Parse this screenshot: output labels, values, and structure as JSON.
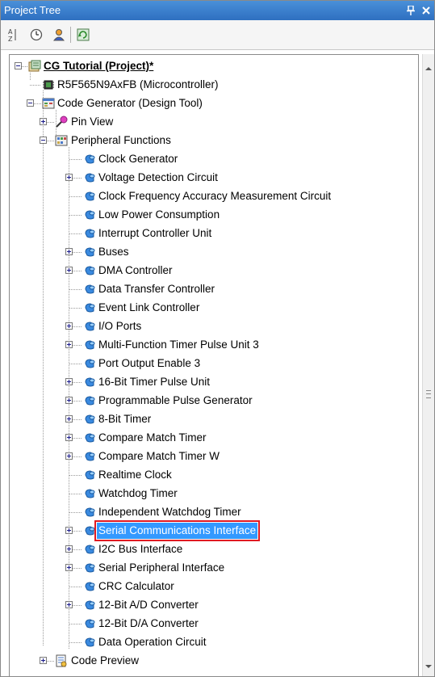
{
  "panel": {
    "title": "Project Tree",
    "pin_glyph": "4",
    "close_glyph": "X"
  },
  "toolbar": {
    "buttons": [
      {
        "icon": "sort-icon"
      },
      {
        "icon": "clock-icon"
      },
      {
        "icon": "user-icon"
      },
      {
        "icon": "refresh-icon"
      }
    ]
  },
  "tree": {
    "project": "CG Tutorial (Project)*",
    "microcontroller": "R5F565N9AxFB (Microcontroller)",
    "code_generator": "Code Generator (Design Tool)",
    "pin_view": "Pin View",
    "peripheral_functions": "Peripheral Functions",
    "peripherals": [
      {
        "label": "Clock Generator",
        "expandable": false
      },
      {
        "label": "Voltage Detection Circuit",
        "expandable": true
      },
      {
        "label": "Clock Frequency Accuracy Measurement Circuit",
        "expandable": false
      },
      {
        "label": "Low Power Consumption",
        "expandable": false
      },
      {
        "label": "Interrupt Controller Unit",
        "expandable": false
      },
      {
        "label": "Buses",
        "expandable": true
      },
      {
        "label": "DMA Controller",
        "expandable": true
      },
      {
        "label": "Data Transfer Controller",
        "expandable": false
      },
      {
        "label": "Event Link Controller",
        "expandable": false
      },
      {
        "label": "I/O Ports",
        "expandable": true
      },
      {
        "label": "Multi-Function Timer Pulse Unit 3",
        "expandable": true
      },
      {
        "label": "Port Output Enable 3",
        "expandable": false
      },
      {
        "label": "16-Bit Timer Pulse Unit",
        "expandable": true
      },
      {
        "label": "Programmable Pulse Generator",
        "expandable": true
      },
      {
        "label": "8-Bit Timer",
        "expandable": true
      },
      {
        "label": "Compare Match Timer",
        "expandable": true
      },
      {
        "label": "Compare Match Timer W",
        "expandable": true
      },
      {
        "label": "Realtime Clock",
        "expandable": false
      },
      {
        "label": "Watchdog Timer",
        "expandable": false
      },
      {
        "label": "Independent Watchdog Timer",
        "expandable": false
      },
      {
        "label": "Serial Communications Interface",
        "expandable": true,
        "selected": true
      },
      {
        "label": "I2C Bus Interface",
        "expandable": true
      },
      {
        "label": "Serial Peripheral Interface",
        "expandable": true
      },
      {
        "label": "CRC Calculator",
        "expandable": false
      },
      {
        "label": "12-Bit A/D Converter",
        "expandable": true
      },
      {
        "label": "12-Bit D/A Converter",
        "expandable": false
      },
      {
        "label": "Data Operation Circuit",
        "expandable": false
      }
    ],
    "code_preview": "Code Preview"
  },
  "colors": {
    "selection": "#3399ff",
    "highlight_box": "#e01a22",
    "title_bar": "#2e6fc0"
  }
}
